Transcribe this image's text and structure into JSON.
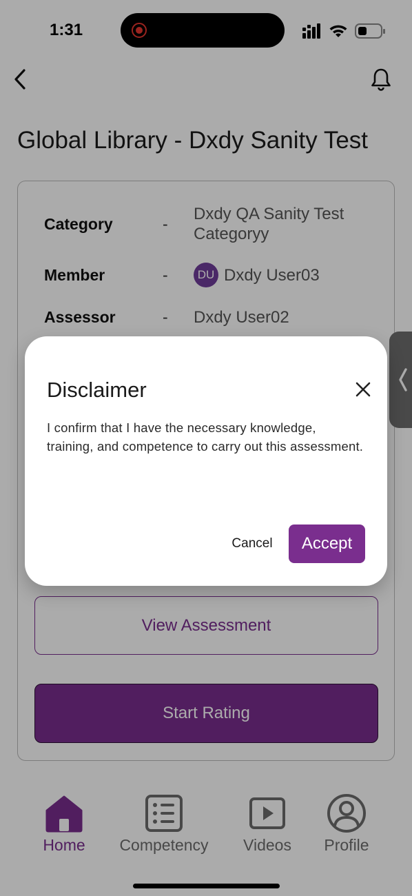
{
  "status_bar": {
    "time": "1:31"
  },
  "header": {
    "title": "Global Library - Dxdy Sanity Test"
  },
  "details": {
    "category_label": "Category",
    "category_value_line1": "Dxdy QA Sanity Test",
    "category_value_line2": "Categoryy",
    "member_label": "Member",
    "member_initials": "DU",
    "member_value": "Dxdy User03",
    "assessor_label": "Assessor",
    "assessor_value": "Dxdy User02",
    "separator": "-"
  },
  "actions": {
    "view_assessment": "View Assessment",
    "start_rating": "Start Rating"
  },
  "nav": {
    "home": "Home",
    "competency": "Competency",
    "videos": "Videos",
    "profile": "Profile"
  },
  "modal": {
    "title": "Disclaimer",
    "body": "I confirm that I have the necessary knowledge, training, and competence to carry out this assessment.",
    "cancel": "Cancel",
    "accept": "Accept"
  },
  "colors": {
    "brand": "#7a2e8e",
    "overlay": "rgba(0,0,0,0.33)"
  }
}
